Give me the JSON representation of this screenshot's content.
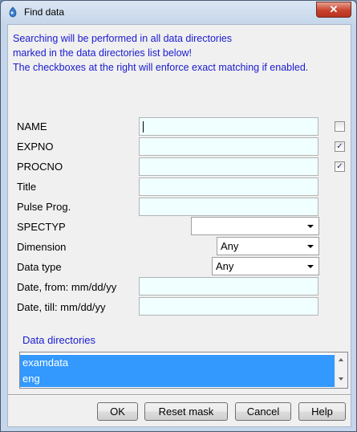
{
  "window": {
    "title": "Find data",
    "close_symbol": "✕"
  },
  "info": {
    "line1": "Searching will be performed in all data directories",
    "line2": "marked in the data directories list below!",
    "line3": "The checkboxes at the right will enforce exact matching if enabled."
  },
  "fields": {
    "name": {
      "label": "NAME",
      "value": "",
      "exact": false
    },
    "expno": {
      "label": "EXPNO",
      "value": "",
      "exact": true
    },
    "procno": {
      "label": "PROCNO",
      "value": "",
      "exact": true
    },
    "title": {
      "label": "Title",
      "value": ""
    },
    "pulse_prog": {
      "label": "Pulse Prog.",
      "value": ""
    },
    "spectyp": {
      "label": "SPECTYP",
      "value": ""
    },
    "dimension": {
      "label": "Dimension",
      "value": "Any"
    },
    "data_type": {
      "label": "Data type",
      "value": "Any"
    },
    "date_from": {
      "label": "Date, from: mm/dd/yy",
      "value": ""
    },
    "date_till": {
      "label": "Date, till: mm/dd/yy",
      "value": ""
    }
  },
  "check_mark": "✓",
  "directories": {
    "label": "Data directories",
    "items": [
      "examdata",
      "eng"
    ]
  },
  "buttons": {
    "ok": "OK",
    "reset": "Reset mask",
    "cancel": "Cancel",
    "help": "Help"
  }
}
